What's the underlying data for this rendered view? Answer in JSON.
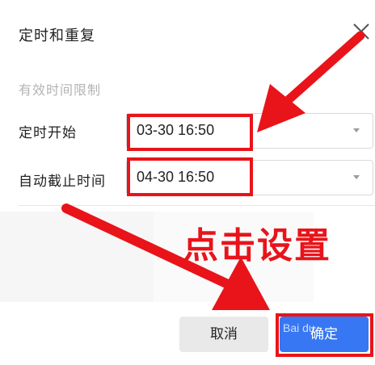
{
  "dialog": {
    "title": "定时和重复",
    "section_label": "有效时间限制",
    "fields": [
      {
        "label": "定时开始",
        "value": "03-30 16:50"
      },
      {
        "label": "自动截止时间",
        "value": "04-30 16:50"
      }
    ],
    "cancel_label": "取消",
    "confirm_label": "确定"
  },
  "annotation": {
    "text": "点击设置",
    "color": "#e8141a"
  },
  "colors": {
    "primary": "#3777f3",
    "annotation_red": "#e8141a",
    "muted_text": "#b3b3b3"
  },
  "icons": {
    "close": "close-icon",
    "caret": "caret-down-icon",
    "arrow": "arrow-annotation-icon"
  }
}
